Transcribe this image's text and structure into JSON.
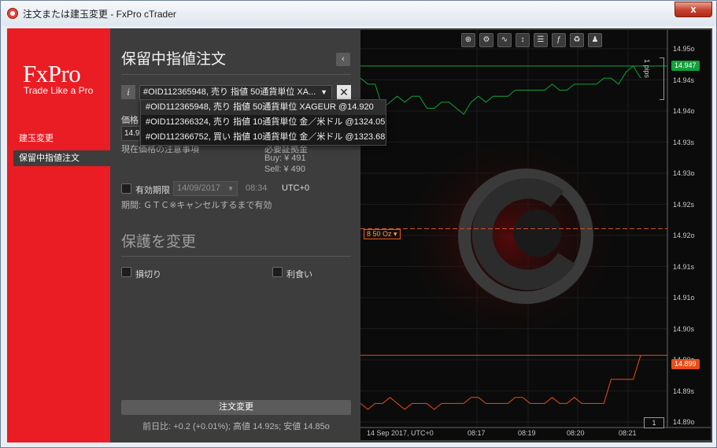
{
  "window": {
    "title": "注文または建玉変更 - FxPro cTrader",
    "close_glyph": "x"
  },
  "brand": {
    "logo": "FxPro",
    "tagline": "Trade Like a Pro",
    "accent_color": "#ea1c24"
  },
  "nav": {
    "items": [
      {
        "label": "建玉変更",
        "active": false
      },
      {
        "label": "保留中指値注文",
        "active": true
      }
    ]
  },
  "form": {
    "title": "保留中指値注文",
    "collapse_glyph": "‹",
    "info_glyph": "i",
    "selected_order": "#OID112365948, 売り 指値 50通貨単位 XA...",
    "clear_glyph": "✕",
    "price_label": "価格",
    "price_value": "14.9",
    "current_label": "現在",
    "current_tail": "価格の注意事項",
    "margin_label": "必要証拠金",
    "buy_margin": "Buy: ¥ 491",
    "sell_margin": "Sell: ¥ 490",
    "expiry_label": "有効期限",
    "expiry_date": "14/09/2017",
    "expiry_time": "08:34",
    "timezone": "UTC+0",
    "period_text": "期間: ＧＴＣ※キャンセルするまで有効",
    "protection_title": "保護を変更",
    "stop_loss_label": "損切り",
    "take_profit_label": "利食い",
    "submit_label": "注文変更",
    "footer_stats": "前日比: +0.2 (+0.01%); 高値 14.92s; 安値 14.85o"
  },
  "dropdown": {
    "options": [
      {
        "label": "#OID112365948, 売り 指値 50通貨単位 XAGEUR @14.920",
        "selected": true
      },
      {
        "label": "#OID112366324, 売り 指値 10通貨単位 金／米ドル @1324.05",
        "selected": false
      },
      {
        "label": "#OID112366752, 買い 指値 10通貨単位 金／米ドル @1323.68",
        "selected": false
      }
    ]
  },
  "chart": {
    "toolbar_icons": [
      "zoom-in-icon",
      "chart-settings-icon",
      "line-chart-icon",
      "period-icon",
      "list-icon",
      "sentiment-icon",
      "reload-icon",
      "user-icon"
    ],
    "toolbar_glyphs": [
      "⊕",
      "⚙",
      "∿",
      "↕",
      "☰",
      "ƒ",
      "♻",
      "♟"
    ],
    "price_axis": [
      "14.95o",
      "14.94s",
      "14.94o",
      "14.93s",
      "14.93o",
      "14.92s",
      "14.92o",
      "14.91s",
      "14.91o",
      "14.90s",
      "14.90o",
      "14.89s",
      "14.89o"
    ],
    "time_axis": [
      "14 Sep 2017, UTC+0",
      "08:17",
      "08:19",
      "08:20",
      "08:21"
    ],
    "ask_price": "14.947",
    "bid_price": "14.899",
    "order_line_label": "8 50 Oz ▾",
    "pips_label": "1 pips",
    "scroll_label": "1",
    "ask_color": "#11a13a",
    "bid_color": "#e84d18",
    "chart_data": {
      "type": "line",
      "series": [
        {
          "values": [
            14.945,
            14.944,
            14.944,
            14.94,
            14.941,
            14.942,
            14.941,
            14.942,
            14.942,
            14.94,
            14.94,
            14.941,
            14.941,
            14.94,
            14.939,
            14.941,
            14.942,
            14.941,
            14.942,
            14.942,
            14.942,
            14.943,
            14.943,
            14.943,
            14.943,
            14.943,
            14.944,
            14.943,
            14.943,
            14.944,
            14.944,
            14.944,
            14.944,
            14.945,
            14.945,
            14.944,
            14.946,
            14.947,
            14.945
          ]
        },
        {
          "values": [
            14.891,
            14.89,
            14.891,
            14.891,
            14.892,
            14.891,
            14.89,
            14.891,
            14.891,
            14.891,
            14.89,
            14.891,
            14.891,
            14.891,
            14.891,
            14.892,
            14.892,
            14.891,
            14.891,
            14.891,
            14.891,
            14.892,
            14.892,
            14.891,
            14.891,
            14.891,
            14.892,
            14.891,
            14.891,
            14.892,
            14.891,
            14.891,
            14.891,
            14.891,
            14.895,
            14.895,
            14.895,
            14.895,
            14.899
          ]
        }
      ],
      "ylim": [
        14.887,
        14.953
      ],
      "order_price": 14.92,
      "ask_level": 14.947,
      "bid_level": 14.899
    }
  }
}
